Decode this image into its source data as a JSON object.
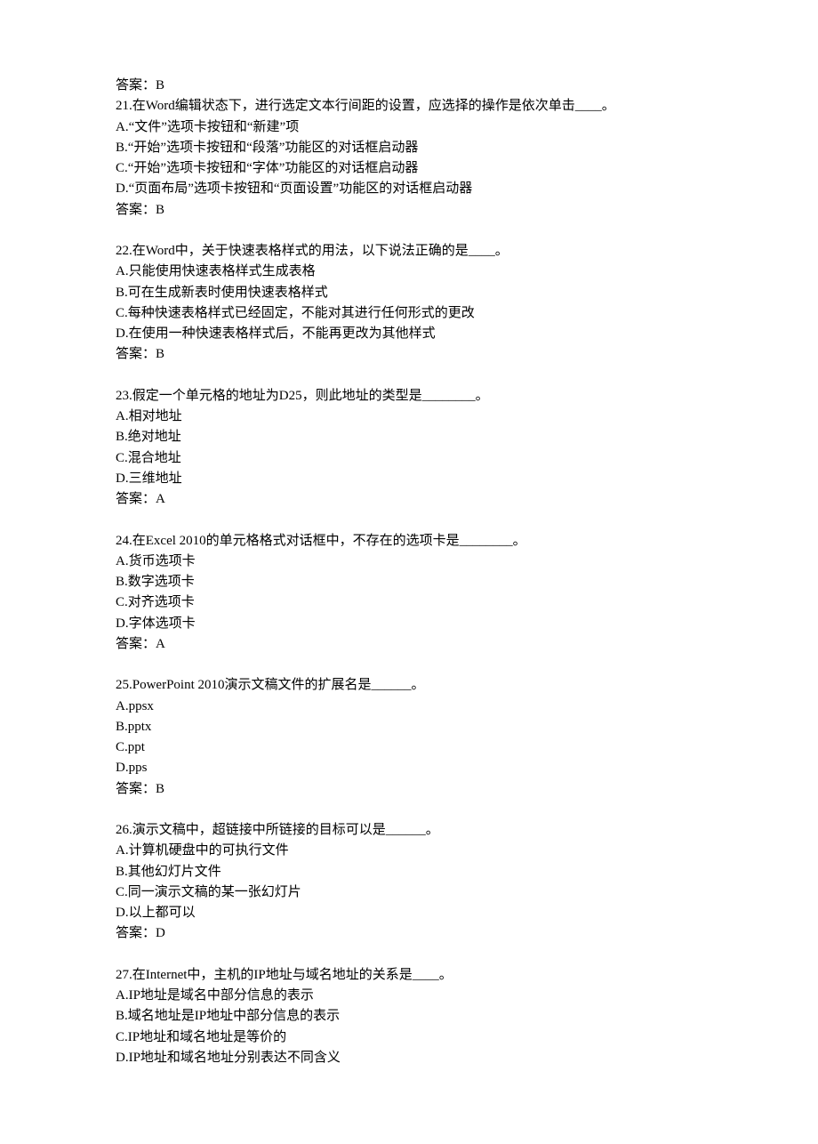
{
  "lines": [
    "答案：B",
    "21.在Word编辑状态下，进行选定文本行间距的设置，应选择的操作是依次单击____。",
    "A.“文件”选项卡按钮和“新建”项",
    "B.“开始”选项卡按钮和“段落”功能区的对话框启动器",
    "C.“开始”选项卡按钮和“字体”功能区的对话框启动器",
    "D.“页面布局”选项卡按钮和“页面设置”功能区的对话框启动器",
    "答案：B",
    "",
    "22.在Word中，关于快速表格样式的用法，以下说法正确的是____。",
    "A.只能使用快速表格样式生成表格",
    "B.可在生成新表时使用快速表格样式",
    "C.每种快速表格样式已经固定，不能对其进行任何形式的更改",
    "D.在使用一种快速表格样式后，不能再更改为其他样式",
    "答案：B",
    "",
    "23.假定一个单元格的地址为D25，则此地址的类型是________。",
    "A.相对地址",
    "B.绝对地址",
    "C.混合地址",
    "D.三维地址",
    "答案：A",
    "",
    "24.在Excel 2010的单元格格式对话框中，不存在的选项卡是________。",
    "A.货币选项卡",
    "B.数字选项卡",
    "C.对齐选项卡",
    "D.字体选项卡",
    "答案：A",
    "",
    "25.PowerPoint 2010演示文稿文件的扩展名是______。",
    "A.ppsx",
    "B.pptx",
    "C.ppt",
    "D.pps",
    "答案：B",
    "",
    "26.演示文稿中，超链接中所链接的目标可以是______。",
    "A.计算机硬盘中的可执行文件",
    "B.其他幻灯片文件",
    "C.同一演示文稿的某一张幻灯片",
    "D.以上都可以",
    "答案：D",
    "",
    "27.在Internet中，主机的IP地址与域名地址的关系是____。",
    "A.IP地址是域名中部分信息的表示",
    "B.域名地址是IP地址中部分信息的表示",
    "C.IP地址和域名地址是等价的",
    "D.IP地址和域名地址分别表达不同含义"
  ]
}
